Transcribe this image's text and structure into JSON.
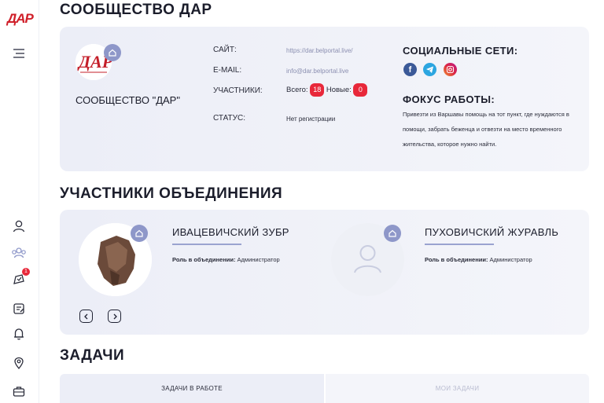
{
  "app": {
    "logo_text": "ДАР"
  },
  "sidebar": {
    "notification_badge": "1",
    "icons": [
      "profile-icon",
      "community-icon",
      "tasks-badge-icon",
      "checklist-icon",
      "bell-icon",
      "map-pin-icon",
      "briefcase-icon"
    ]
  },
  "community": {
    "title": "СООБЩЕСТВО ДАР",
    "name": "СООБЩЕСТВО \"ДАР\"",
    "site_label": "САЙТ:",
    "site_value": "https://dar.belportal.live/",
    "email_label": "E-MAIL:",
    "email_value": "info@dar.belportal.live",
    "members_label": "УЧАСТНИКИ:",
    "total_label": "Всего:",
    "total_count": "18",
    "new_label": "Новые:",
    "new_count": "0",
    "status_label": "СТАТУС:",
    "status_value": "Нет регистрации",
    "social_title": "СОЦИАЛЬНЫЕ СЕТИ:",
    "focus_title": "ФОКУС РАБОТЫ:",
    "focus_text": "Привезти из Варшавы помощь на тот пункт, где нуждаются в помощи, забрать беженца и отвезти на место временного жительства, которое нужно найти."
  },
  "members_section": {
    "title": "УЧАСТНИКИ ОБЪЕДИНЕНИЯ",
    "role_label": "Роль в объединении:",
    "members": [
      {
        "name": "ИВАЦЕВИЧСКИЙ ЗУБР",
        "role": "Администратор"
      },
      {
        "name": "ПУХОВИЧСКИЙ ЖУРАВЛЬ",
        "role": "Администратор"
      }
    ]
  },
  "tasks": {
    "title": "ЗАДАЧИ",
    "tab_in_progress": "ЗАДАЧИ В РАБОТЕ",
    "tab_mine": "МОИ ЗАДАЧИ"
  },
  "colors": {
    "accent": "#8e97c9",
    "badge_red": "#e8283a",
    "card_bg": "#eceef7",
    "facebook": "#3b5998",
    "telegram": "#2ca5e0",
    "instagram": "#d6249f"
  }
}
